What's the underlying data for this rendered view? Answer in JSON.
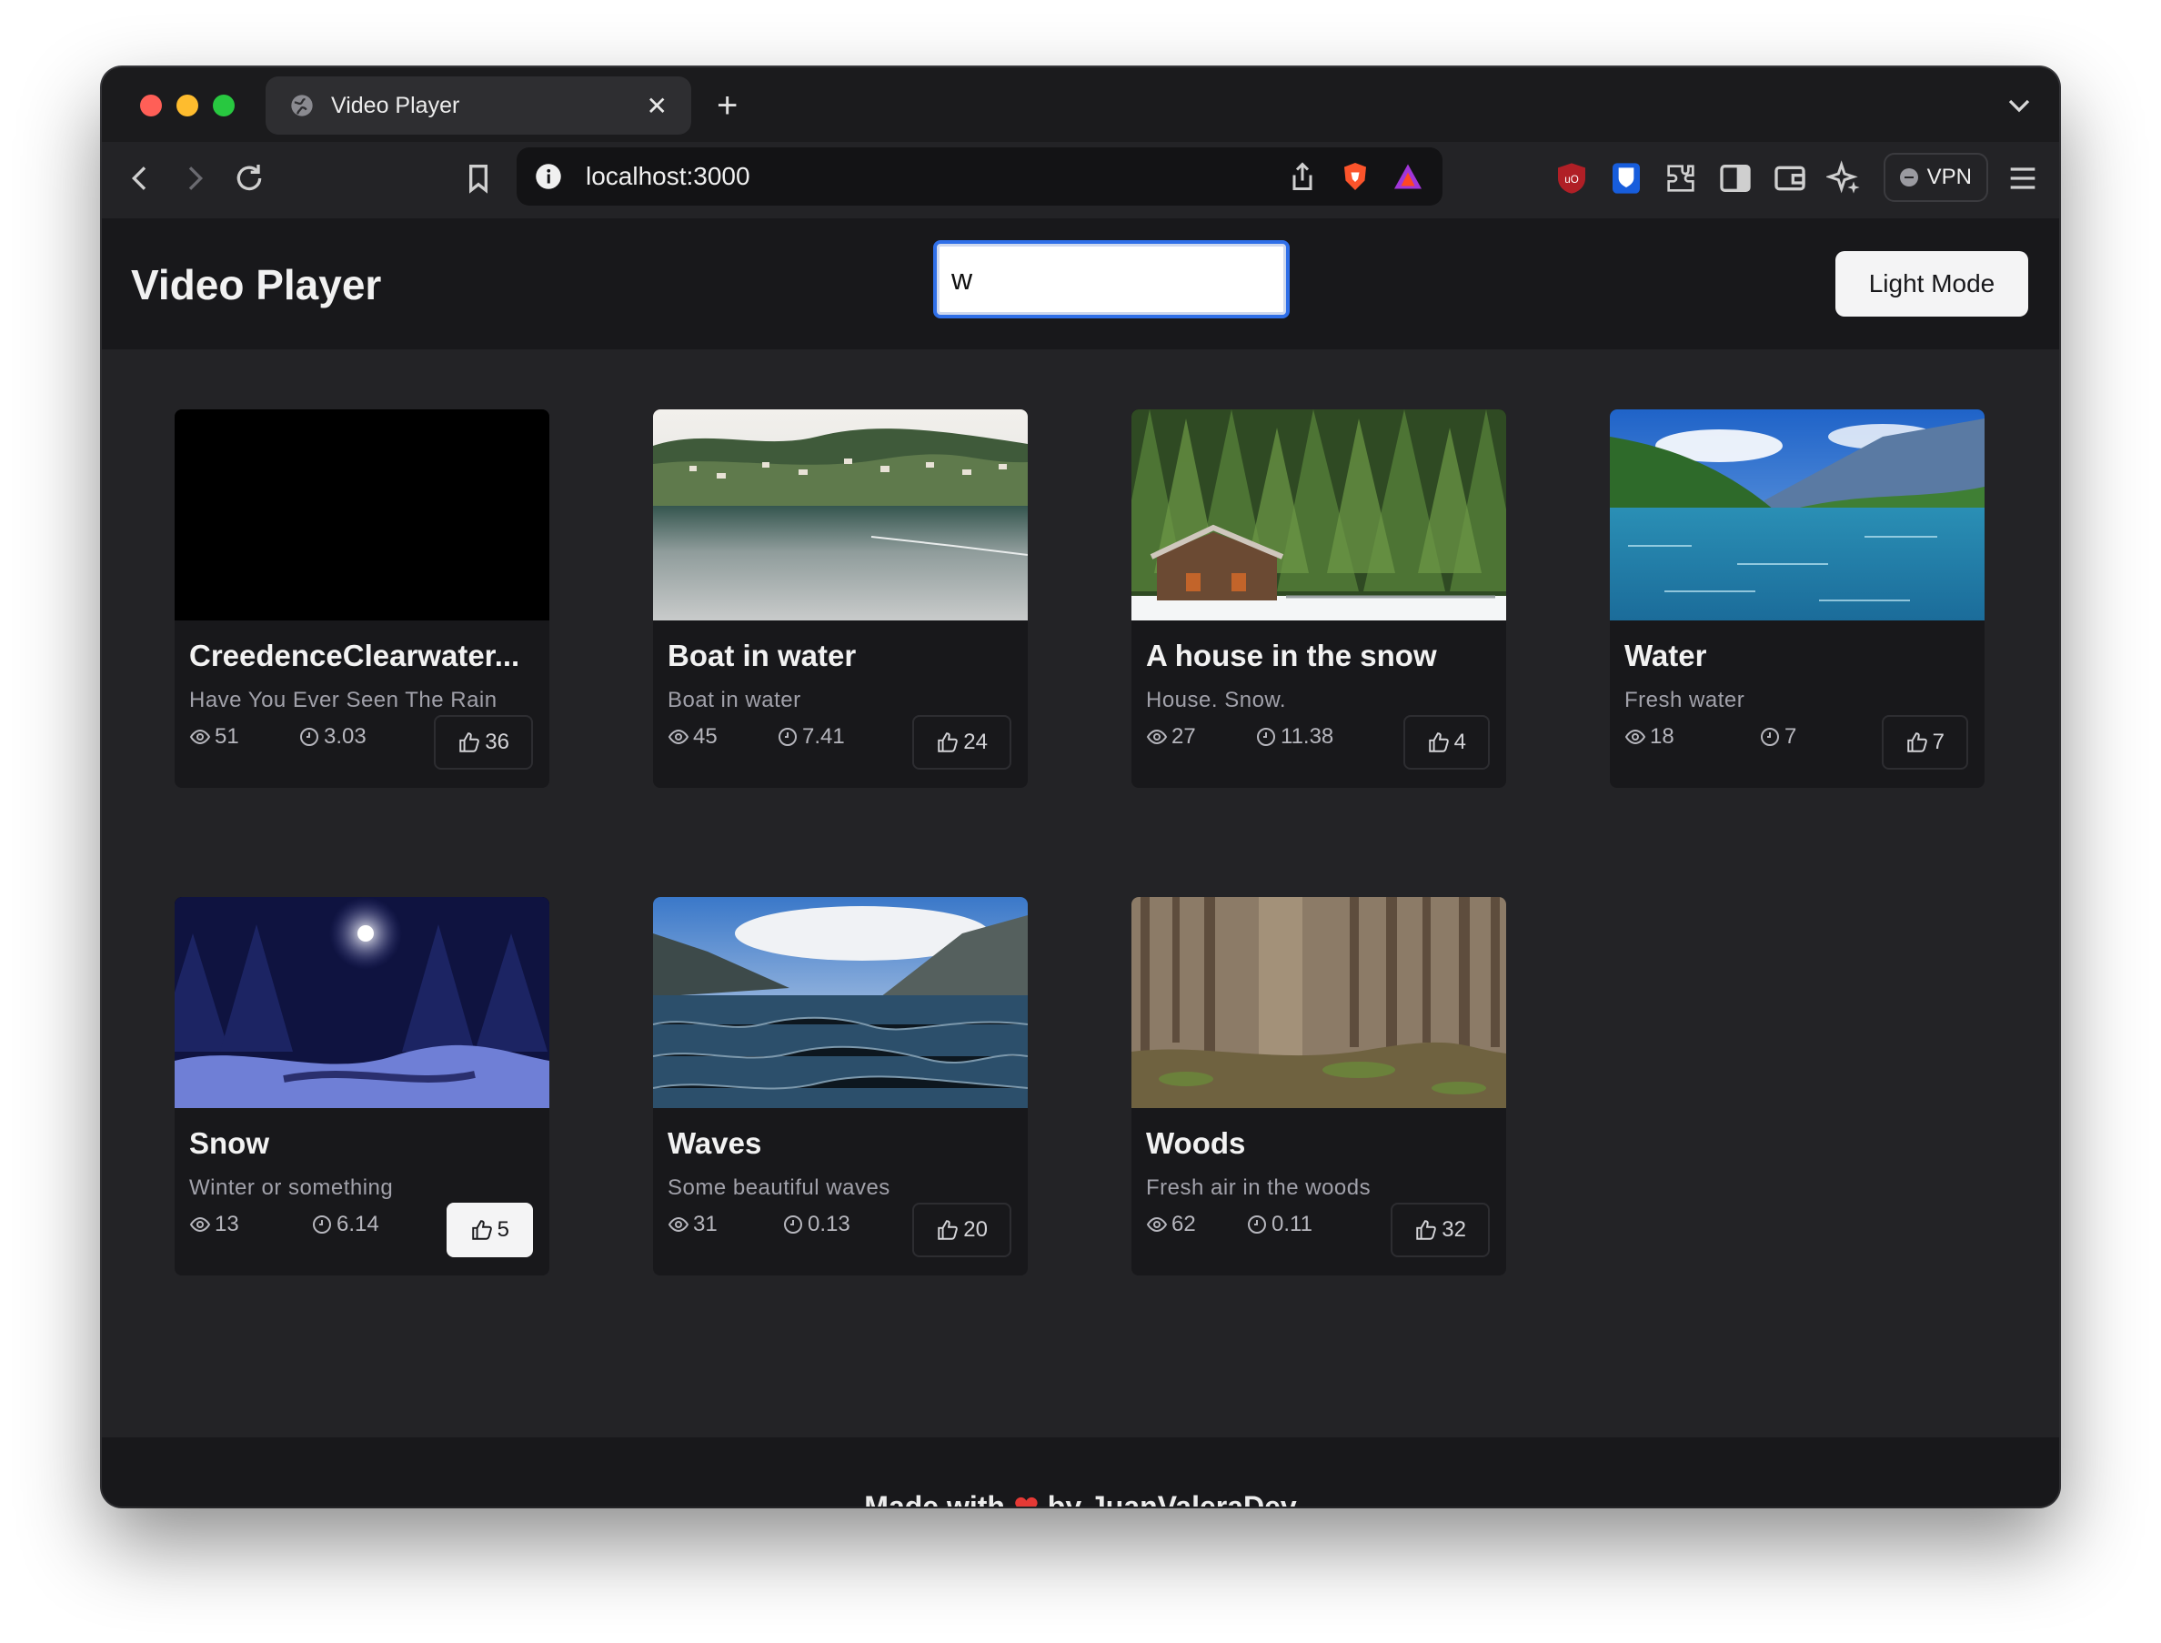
{
  "browser": {
    "tab_title": "Video Player",
    "url": "localhost:3000",
    "vpn_label": "VPN"
  },
  "app": {
    "title": "Video Player",
    "search_value": "w",
    "mode_button": "Light Mode"
  },
  "videos": [
    {
      "title": "CreedenceClearwater...",
      "description": "Have You Ever Seen The Rain",
      "views": "51",
      "duration": "3.03",
      "likes": "36",
      "liked": false,
      "thumbnail": "black"
    },
    {
      "title": "Boat in water",
      "description": "Boat in water",
      "views": "45",
      "duration": "7.41",
      "likes": "24",
      "liked": false,
      "thumbnail": "lake-village"
    },
    {
      "title": "A house in the snow",
      "description": "House. Snow.",
      "views": "27",
      "duration": "11.38",
      "likes": "4",
      "liked": false,
      "thumbnail": "cabin-forest"
    },
    {
      "title": "Water",
      "description": "Fresh water",
      "views": "18",
      "duration": "7",
      "likes": "7",
      "liked": false,
      "thumbnail": "mountain-river"
    },
    {
      "title": "Snow",
      "description": "Winter or something",
      "views": "13",
      "duration": "6.14",
      "likes": "5",
      "liked": true,
      "thumbnail": "night-snow"
    },
    {
      "title": "Waves",
      "description": "Some beautiful waves",
      "views": "31",
      "duration": "0.13",
      "likes": "20",
      "liked": false,
      "thumbnail": "mountain-lake-waves"
    },
    {
      "title": "Woods",
      "description": "Fresh air in the woods",
      "views": "62",
      "duration": "0.11",
      "likes": "32",
      "liked": false,
      "thumbnail": "forest-trunks"
    }
  ],
  "footer": {
    "before": "Made with",
    "heart": "❤",
    "after": "by JuanValeraDev"
  },
  "colors": {
    "accent_focus": "#2f6fe8",
    "like_heart": "#e53935"
  }
}
